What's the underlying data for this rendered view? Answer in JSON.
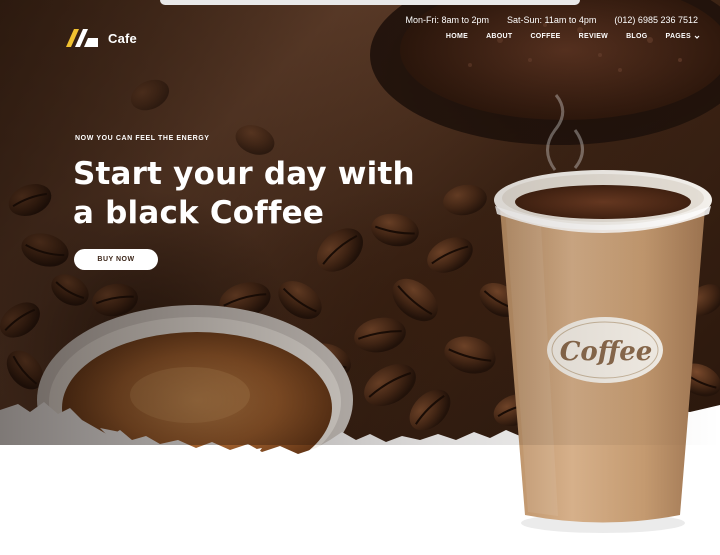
{
  "brand": {
    "name": "Cafe"
  },
  "info": {
    "weekday_hours": "Mon-Fri: 8am to 2pm",
    "weekend_hours": "Sat-Sun: 11am to 4pm",
    "phone": "(012) 6985 236 7512"
  },
  "nav": {
    "items": [
      "HOME",
      "ABOUT",
      "COFFEE",
      "REVIEW",
      "BLOG",
      "PAGES"
    ]
  },
  "hero": {
    "eyebrow": "NOW YOU CAN FEEL THE ENERGY",
    "headline_line1": "Start your day with",
    "headline_line2": "a black Coffee",
    "button_label": "BUY NOW"
  },
  "cup": {
    "label": "Coffee"
  },
  "colors": {
    "brand_yellow": "#f2c230",
    "cup_body": "#c9a27a",
    "coffee_dark": "#3b2518"
  },
  "icons": {
    "logo": "cafe-logo-mark",
    "pages_menu": "chevron-down-icon"
  }
}
